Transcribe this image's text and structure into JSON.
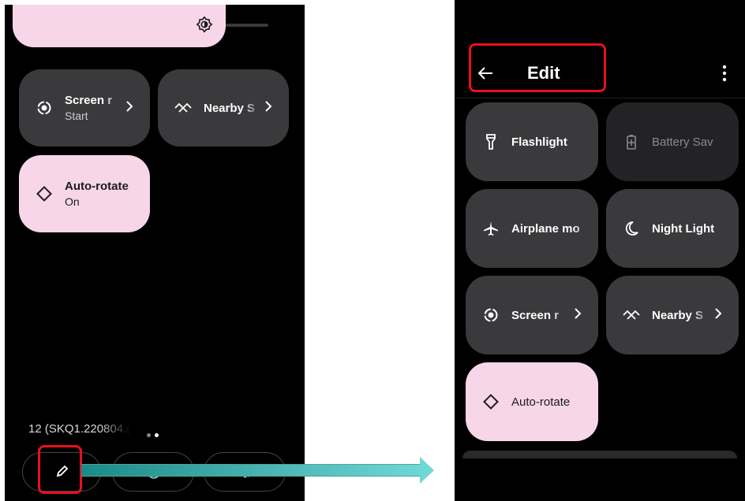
{
  "left_panel": {
    "tiles": [
      {
        "label": "Screen r",
        "sub": "Start",
        "icon": "screen-record-icon",
        "state": "dark"
      },
      {
        "label": "Nearby S",
        "icon": "nearby-share-icon",
        "state": "dark"
      },
      {
        "label": "Auto-rotate",
        "sub": "On",
        "icon": "auto-rotate-icon",
        "state": "pink"
      }
    ],
    "build_number": "12 (SKQ1.220804.(",
    "bottom_buttons": [
      "edit-icon",
      "power-icon",
      "settings-icon"
    ]
  },
  "right_panel": {
    "title": "Edit",
    "tiles": [
      {
        "label": "Flashlight",
        "icon": "flashlight-icon",
        "state": "dark"
      },
      {
        "label": "Battery Sav",
        "icon": "battery-saver-icon",
        "state": "dim"
      },
      {
        "label": "Airplane mo",
        "icon": "airplane-icon",
        "state": "dark"
      },
      {
        "label": "Night Light",
        "icon": "night-light-icon",
        "state": "dark"
      },
      {
        "label": "Screen r",
        "icon": "screen-record-icon",
        "state": "dark"
      },
      {
        "label": "Nearby S",
        "icon": "nearby-share-icon",
        "state": "dark"
      },
      {
        "label": "Auto-rotate",
        "icon": "auto-rotate-icon",
        "state": "pink"
      }
    ]
  },
  "colors": {
    "tile_active": "#f7d6ea",
    "tile_inactive": "#3a393c",
    "highlight": "#e8111b",
    "arrow": "#2ea6a2"
  }
}
